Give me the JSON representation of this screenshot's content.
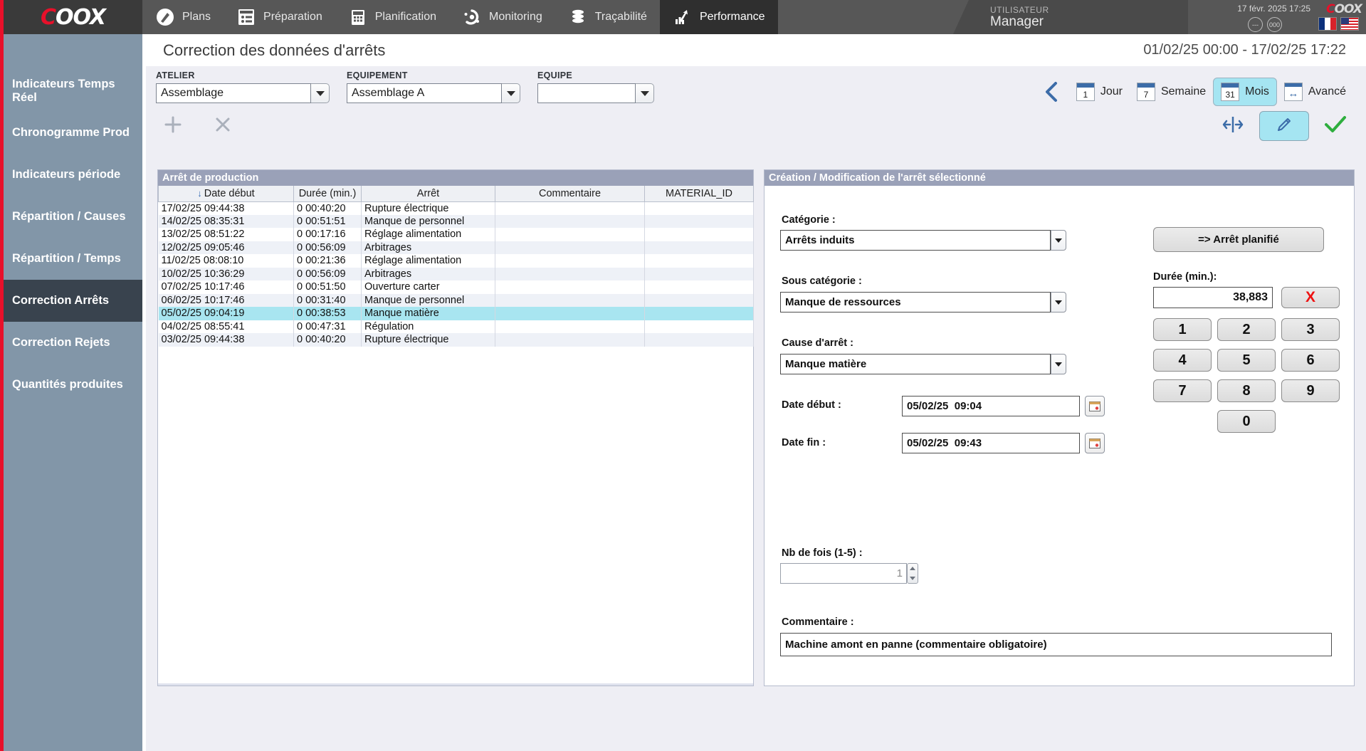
{
  "topnav": {
    "logo": "COOX",
    "items": [
      {
        "label": "Plans",
        "icon": "pencil-circle-icon",
        "active": false
      },
      {
        "label": "Préparation",
        "icon": "list-grid-icon",
        "active": false
      },
      {
        "label": "Planification",
        "icon": "calendar-icon",
        "active": false
      },
      {
        "label": "Monitoring",
        "icon": "gear-dots-icon",
        "active": false
      },
      {
        "label": "Traçabilité",
        "icon": "database-stack-icon",
        "active": false
      },
      {
        "label": "Performance",
        "icon": "bar-chart-arrow-icon",
        "active": true
      }
    ],
    "user_label": "UTILISATEUR",
    "user_name": "Manager",
    "datetime": "17 févr. 2025 17:25",
    "circle_buttons": [
      "---",
      "000"
    ],
    "flags": [
      "flag-fr",
      "flag-us"
    ],
    "logo_small": "COOX"
  },
  "sidebar": {
    "items": [
      {
        "label": "Indicateurs Temps Réel",
        "active": false
      },
      {
        "label": "Chronogramme Prod",
        "active": false
      },
      {
        "label": "Indicateurs période",
        "active": false
      },
      {
        "label": "Répartition / Causes",
        "active": false
      },
      {
        "label": "Répartition / Temps",
        "active": false
      },
      {
        "label": "Correction Arrêts",
        "active": true
      },
      {
        "label": "Correction Rejets",
        "active": false
      },
      {
        "label": "Quantités produites",
        "active": false
      }
    ]
  },
  "page": {
    "title": "Correction des données d'arrêts",
    "date_range": "01/02/25 00:00 - 17/02/25 17:22"
  },
  "filters": [
    {
      "label": "ATELIER",
      "value": "Assemblage"
    },
    {
      "label": "EQUIPEMENT",
      "value": "Assemblage A"
    },
    {
      "label": "EQUIPE",
      "value": ""
    }
  ],
  "datenav": {
    "prev_icon": "chevron-left-icon",
    "buttons": [
      {
        "glyph": "1",
        "label": "Jour",
        "selected": false,
        "icon": "calendar-icon"
      },
      {
        "glyph": "7",
        "label": "Semaine",
        "selected": false,
        "icon": "calendar-icon"
      },
      {
        "glyph": "31",
        "label": "Mois",
        "selected": true,
        "icon": "calendar-icon"
      },
      {
        "glyph": "↔",
        "label": "Avancé",
        "selected": false,
        "icon": "arrows-horizontal-icon"
      }
    ]
  },
  "actionbar": {
    "add_icon": "plus-icon",
    "delete_icon": "close-x-icon",
    "split_icon": "split-arrows-icon",
    "edit_icon": "pencil-icon",
    "validate_icon": "check-icon"
  },
  "table": {
    "title": "Arrêt de production",
    "sort_indicator": "↓",
    "columns": [
      "Date début",
      "Durée (min.)",
      "Arrêt",
      "Commentaire",
      "MATERIAL_ID"
    ],
    "rows": [
      {
        "date": "17/02/25 09:44:38",
        "duree": "0 00:40:20",
        "arret": "Rupture électrique",
        "commentaire": "",
        "material_id": "",
        "selected": false
      },
      {
        "date": "14/02/25 08:35:31",
        "duree": "0 00:51:51",
        "arret": "Manque de personnel",
        "commentaire": "",
        "material_id": "",
        "selected": false
      },
      {
        "date": "13/02/25 08:51:22",
        "duree": "0 00:17:16",
        "arret": "Réglage alimentation",
        "commentaire": "",
        "material_id": "",
        "selected": false
      },
      {
        "date": "12/02/25 09:05:46",
        "duree": "0 00:56:09",
        "arret": "Arbitrages",
        "commentaire": "",
        "material_id": "",
        "selected": false
      },
      {
        "date": "11/02/25 08:08:10",
        "duree": "0 00:21:36",
        "arret": "Réglage alimentation",
        "commentaire": "",
        "material_id": "",
        "selected": false
      },
      {
        "date": "10/02/25 10:36:29",
        "duree": "0 00:56:09",
        "arret": "Arbitrages",
        "commentaire": "",
        "material_id": "",
        "selected": false
      },
      {
        "date": "07/02/25 10:17:46",
        "duree": "0 00:51:50",
        "arret": "Ouverture carter",
        "commentaire": "",
        "material_id": "",
        "selected": false
      },
      {
        "date": "06/02/25 10:17:46",
        "duree": "0 00:31:40",
        "arret": "Manque de personnel",
        "commentaire": "",
        "material_id": "",
        "selected": false
      },
      {
        "date": "05/02/25 09:04:19",
        "duree": "0 00:38:53",
        "arret": "Manque matière",
        "commentaire": "",
        "material_id": "",
        "selected": true
      },
      {
        "date": "04/02/25 08:55:41",
        "duree": "0 00:47:31",
        "arret": "Régulation",
        "commentaire": "",
        "material_id": "",
        "selected": false
      },
      {
        "date": "03/02/25 09:44:38",
        "duree": "0 00:40:20",
        "arret": "Rupture électrique",
        "commentaire": "",
        "material_id": "",
        "selected": false
      }
    ]
  },
  "form": {
    "title": "Création / Modification de l'arrêt sélectionné",
    "categorie_label": "Catégorie :",
    "categorie_value": "Arrêts induits",
    "sous_categorie_label": "Sous catégorie :",
    "sous_categorie_value": "Manque de ressources",
    "cause_label": "Cause d'arrêt :",
    "cause_value": "Manque matière",
    "date_debut_label": "Date début :",
    "date_debut_value": "05/02/25  09:04",
    "date_fin_label": "Date fin :",
    "date_fin_value": "05/02/25  09:43",
    "nb_fois_label": "Nb de fois (1-5) :",
    "nb_fois_value": "1",
    "commentaire_label": "Commentaire :",
    "commentaire_value": "Machine amont en panne (commentaire obligatoire)",
    "arret_planifie_label": "=> Arrêt planifié",
    "duree_label": "Durée (min.):",
    "duree_value": "38,883",
    "clear_label": "X",
    "keypad": [
      "1",
      "2",
      "3",
      "4",
      "5",
      "6",
      "7",
      "8",
      "9",
      "0"
    ]
  },
  "colors": {
    "brand_red": "#e8102a",
    "accent_cyan": "#a5e5f2",
    "topbar": "#575757",
    "sidebar": "#8296a8",
    "sidebar_active": "#39434e",
    "panel_header": "#9aa1b8",
    "selected_row": "#a8e5f0",
    "validate_green": "#2eae3e",
    "clear_red": "#ee1111"
  }
}
